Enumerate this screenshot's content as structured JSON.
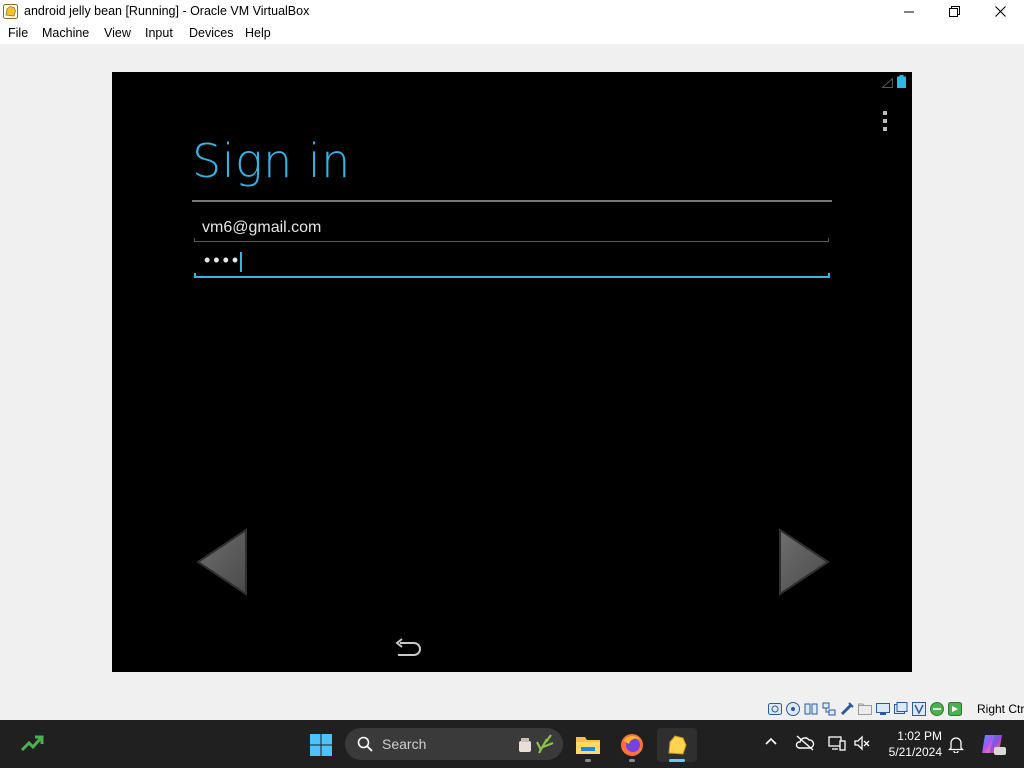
{
  "window": {
    "title": "android jelly bean [Running] - Oracle VM VirtualBox",
    "controls": [
      "minimize",
      "maximize",
      "close"
    ]
  },
  "menubar": {
    "items": [
      {
        "label": "File"
      },
      {
        "label": "Machine"
      },
      {
        "label": "View"
      },
      {
        "label": "Input"
      },
      {
        "label": "Devices"
      },
      {
        "label": "Help"
      }
    ]
  },
  "android": {
    "heading": "Sign in",
    "email_value": "vm6@gmail.com",
    "password_value": "••••",
    "accent_color": "#33b5e5",
    "icons": [
      "signal-icon",
      "battery-icon",
      "overflow-menu-icon",
      "back-arrow-icon",
      "next-arrow-icon",
      "nav-back-icon"
    ]
  },
  "vm_statusbar": {
    "host_key_label": "Right Ctrl",
    "icons": [
      "hard-disk-icon",
      "optical-drive-icon",
      "audio-icon",
      "network-icon",
      "usb-icon",
      "shared-folders-icon",
      "display-icon",
      "video-capture-icon",
      "recording-icon",
      "cpu-icon",
      "mouse-integration-icon"
    ]
  },
  "taskbar": {
    "search_label": "Search",
    "apps": [
      "file-explorer-icon",
      "firefox-icon",
      "virtualbox-icon"
    ],
    "active_app": "virtualbox-icon",
    "time": "1:02 PM",
    "date": "5/21/2024",
    "tray_icons": [
      "chevron-up-icon",
      "onedrive-offline-icon",
      "display-tray-icon",
      "volume-muted-icon",
      "notifications-bell-icon",
      "copilot-icon"
    ]
  }
}
